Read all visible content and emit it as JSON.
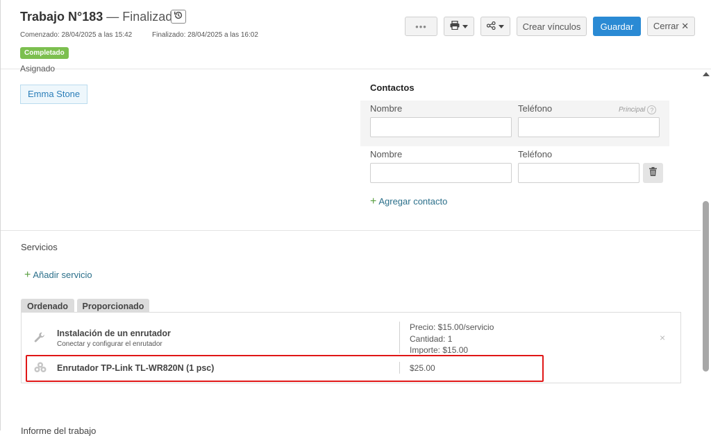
{
  "header": {
    "job_label": "Trabajo N°183",
    "separator": "—",
    "status": "Finalizado",
    "started": "Comenzado: 28/04/2025 a las 15:42",
    "finished": "Finalizado: 28/04/2025 a las 16:02",
    "badge": "Completado",
    "buttons": {
      "more": "•••",
      "create_links": "Crear vínculos",
      "save": "Guardar",
      "close": "Cerrar ✕"
    }
  },
  "assigned": {
    "label": "Asignado",
    "person": "Emma Stone"
  },
  "contacts": {
    "title": "Contactos",
    "name_label": "Nombre",
    "phone_label": "Teléfono",
    "principal_label": "Principal",
    "help": "?",
    "add_label": "Agregar contacto",
    "rows": [
      {
        "name": "",
        "phone": ""
      },
      {
        "name": "",
        "phone": ""
      }
    ]
  },
  "services": {
    "title": "Servicios",
    "add_label": "Añadir servicio",
    "tabs": [
      "Ordenado",
      "Proporcionado"
    ],
    "items": [
      {
        "name": "Instalación de un enrutador",
        "desc": "Conectar y configurar el enrutador",
        "price": "Precio: $15.00/servicio",
        "qty": "Cantidad: 1",
        "amount": "Importe: $15.00"
      },
      {
        "name": "Enrutador TP-Link TL-WR820N (1 psc)",
        "price": "$25.00"
      }
    ],
    "remove": "×"
  },
  "footer_text": "Informe del trabajo"
}
